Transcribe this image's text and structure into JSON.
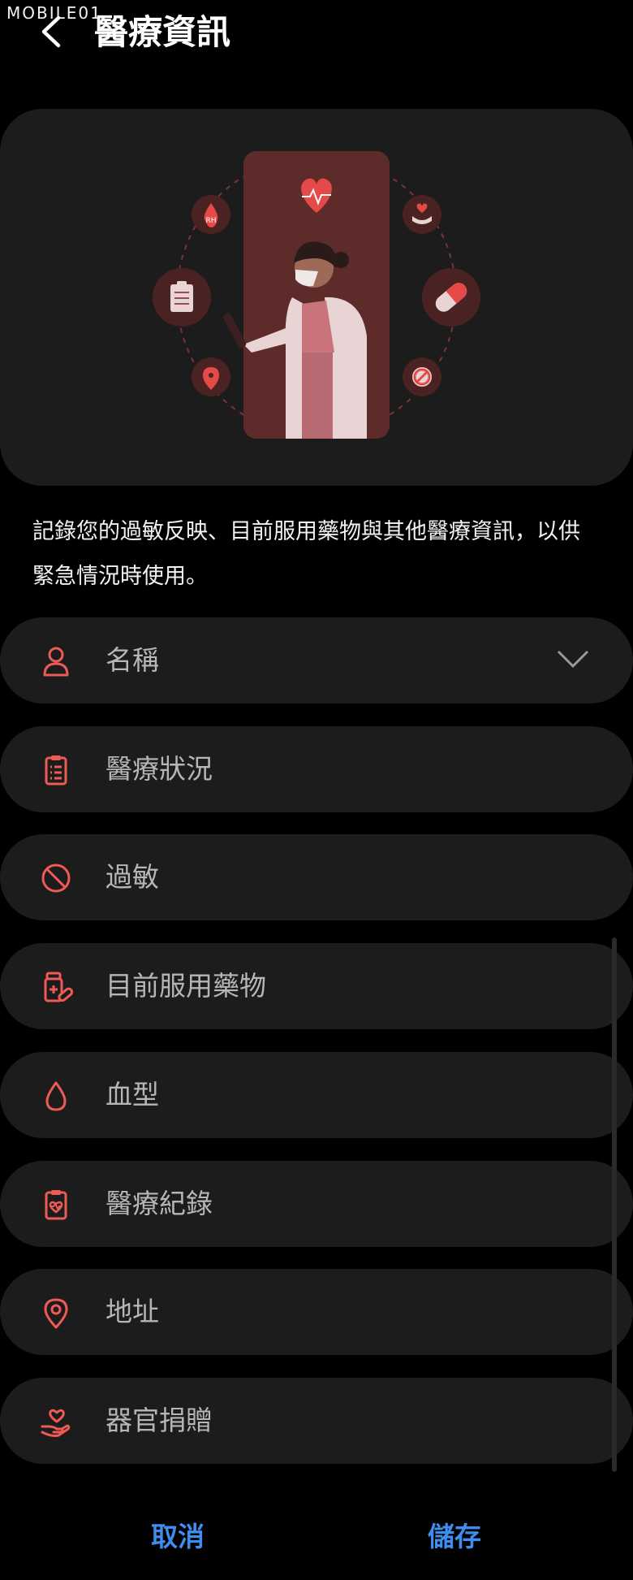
{
  "watermark": "MOBILE01",
  "header": {
    "title": "醫療資訊"
  },
  "description": "記錄您的過敏反映、目前服用藥物與其他醫療資訊，以供緊急情況時使用。",
  "hero": {
    "badge": "RH"
  },
  "items": [
    {
      "label": "名稱",
      "icon": "person-icon"
    },
    {
      "label": "醫療狀況",
      "icon": "clipboard-list-icon"
    },
    {
      "label": "過敏",
      "icon": "prohibited-icon"
    },
    {
      "label": "目前服用藥物",
      "icon": "medicine-bottle-icon"
    },
    {
      "label": "血型",
      "icon": "blood-drop-icon"
    },
    {
      "label": "醫療紀錄",
      "icon": "clipboard-heart-icon"
    },
    {
      "label": "地址",
      "icon": "location-pin-icon"
    },
    {
      "label": "器官捐贈",
      "icon": "hand-heart-icon"
    }
  ],
  "footer": {
    "cancel": "取消",
    "save": "儲存"
  },
  "colors": {
    "accent": "#ee5a55",
    "button": "#3e8ef0",
    "panel": "#1c1c1c"
  }
}
